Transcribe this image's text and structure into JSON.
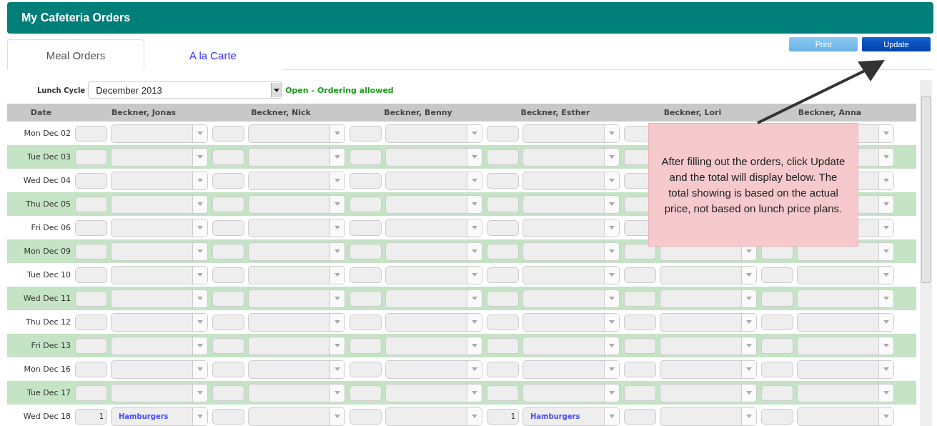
{
  "title": "My Cafeteria Orders",
  "tabs": [
    {
      "label": "Meal Orders",
      "selected": true
    },
    {
      "label": "A la Carte",
      "selected": false
    }
  ],
  "buttons": [
    {
      "label": "Print",
      "disabled": true
    },
    {
      "label": "Update",
      "disabled": false
    }
  ],
  "lunch_cycle": {
    "label": "Lunch Cycle",
    "value": "December 2013",
    "status": "Open - Ordering allowed"
  },
  "columns": [
    "Date",
    "Beckner, Jonas",
    "Beckner, Nick",
    "Beckner, Benny",
    "Beckner, Esther",
    "Beckner, Lori",
    "Beckner, Anna"
  ],
  "rows": [
    {
      "date": "Mon Dec 02"
    },
    {
      "date": "Tue Dec 03"
    },
    {
      "date": "Wed Dec 04"
    },
    {
      "date": "Thu Dec 05"
    },
    {
      "date": "Fri Dec 06"
    },
    {
      "date": "Mon Dec 09"
    },
    {
      "date": "Tue Dec 10"
    },
    {
      "date": "Wed Dec 11"
    },
    {
      "date": "Thu Dec 12"
    },
    {
      "date": "Fri Dec 13"
    },
    {
      "date": "Mon Dec 16"
    },
    {
      "date": "Tue Dec 17"
    },
    {
      "date": "Wed Dec 18",
      "orders": [
        {
          "kind": "ordered",
          "qty": "1",
          "item": "Hamburgers"
        },
        {
          "kind": "blank"
        },
        {
          "kind": "blank"
        },
        {
          "kind": "ordered",
          "qty": "1",
          "item": "Hamburgers"
        },
        {
          "kind": "blank"
        },
        {
          "kind": "blank"
        }
      ]
    }
  ],
  "callout": "After filling out the orders, click Update and the total will display below.  The total showing is based on the actual price, not based on lunch price plans."
}
